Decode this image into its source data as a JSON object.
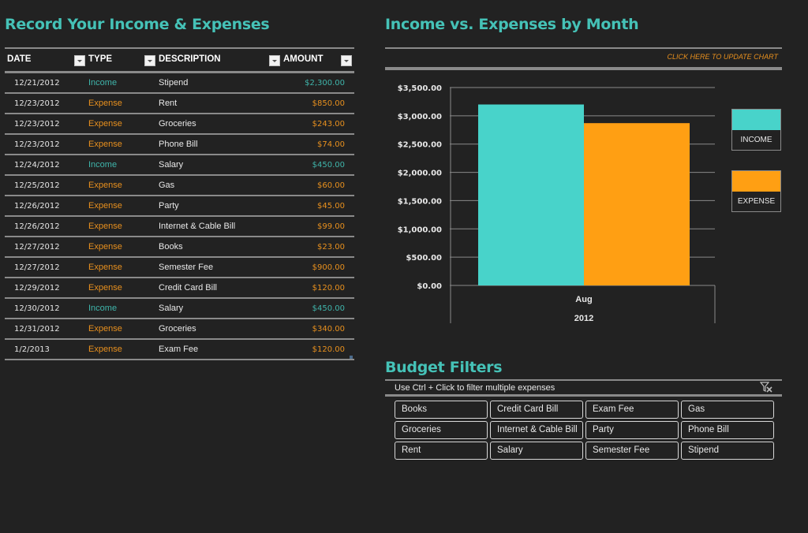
{
  "left": {
    "title": "Record Your Income & Expenses",
    "columns": [
      "DATE",
      "TYPE",
      "DESCRIPTION",
      "AMOUNT"
    ],
    "rows": [
      {
        "date": "12/21/2012",
        "type": "Income",
        "description": "Stipend",
        "amount": "$2,300.00"
      },
      {
        "date": "12/23/2012",
        "type": "Expense",
        "description": "Rent",
        "amount": "$850.00"
      },
      {
        "date": "12/23/2012",
        "type": "Expense",
        "description": "Groceries",
        "amount": "$243.00"
      },
      {
        "date": "12/23/2012",
        "type": "Expense",
        "description": "Phone Bill",
        "amount": "$74.00"
      },
      {
        "date": "12/24/2012",
        "type": "Income",
        "description": "Salary",
        "amount": "$450.00"
      },
      {
        "date": "12/25/2012",
        "type": "Expense",
        "description": "Gas",
        "amount": "$60.00"
      },
      {
        "date": "12/26/2012",
        "type": "Expense",
        "description": "Party",
        "amount": "$45.00"
      },
      {
        "date": "12/26/2012",
        "type": "Expense",
        "description": "Internet & Cable Bill",
        "amount": "$99.00"
      },
      {
        "date": "12/27/2012",
        "type": "Expense",
        "description": "Books",
        "amount": "$23.00"
      },
      {
        "date": "12/27/2012",
        "type": "Expense",
        "description": "Semester Fee",
        "amount": "$900.00"
      },
      {
        "date": "12/29/2012",
        "type": "Expense",
        "description": "Credit Card Bill",
        "amount": "$120.00"
      },
      {
        "date": "12/30/2012",
        "type": "Income",
        "description": "Salary",
        "amount": "$450.00"
      },
      {
        "date": "12/31/2012",
        "type": "Expense",
        "description": "Groceries",
        "amount": "$340.00"
      },
      {
        "date": "1/2/2013",
        "type": "Expense",
        "description": "Exam Fee",
        "amount": "$120.00"
      }
    ]
  },
  "chart": {
    "title": "Income vs. Expenses by Month",
    "update_link": "CLICK HERE  TO UPDATE CHART",
    "legend": [
      {
        "label": "INCOME",
        "color": "#48d3ca"
      },
      {
        "label": "EXPENSE",
        "color": "#ff9f13"
      }
    ]
  },
  "chart_data": {
    "type": "bar",
    "title": "Income vs. Expenses by Month",
    "categories": [
      "Aug"
    ],
    "category_group": "2012",
    "series": [
      {
        "name": "INCOME",
        "values": [
          3200
        ],
        "color": "#48d3ca"
      },
      {
        "name": "EXPENSE",
        "values": [
          2870
        ],
        "color": "#ff9f13"
      }
    ],
    "ylim": [
      0,
      3500
    ],
    "yticks": [
      0,
      500,
      1000,
      1500,
      2000,
      2500,
      3000,
      3500
    ],
    "ytick_labels": [
      "$0.00",
      "$500.00",
      "$1,000.00",
      "$1,500.00",
      "$2,000.00",
      "$2,500.00",
      "$3,000.00",
      "$3,500.00"
    ],
    "xlabel": "",
    "ylabel": "",
    "grid": true,
    "legend_position": "right"
  },
  "filters": {
    "title": "Budget Filters",
    "hint": "Use Ctrl + Click to filter multiple expenses",
    "clear_icon": "clear-filter-icon",
    "items": [
      "Books",
      "Credit Card Bill",
      "Exam Fee",
      "Gas",
      "Groceries",
      "Internet & Cable Bill",
      "Party",
      "Phone Bill",
      "Rent",
      "Salary",
      "Semester Fee",
      "Stipend"
    ]
  }
}
